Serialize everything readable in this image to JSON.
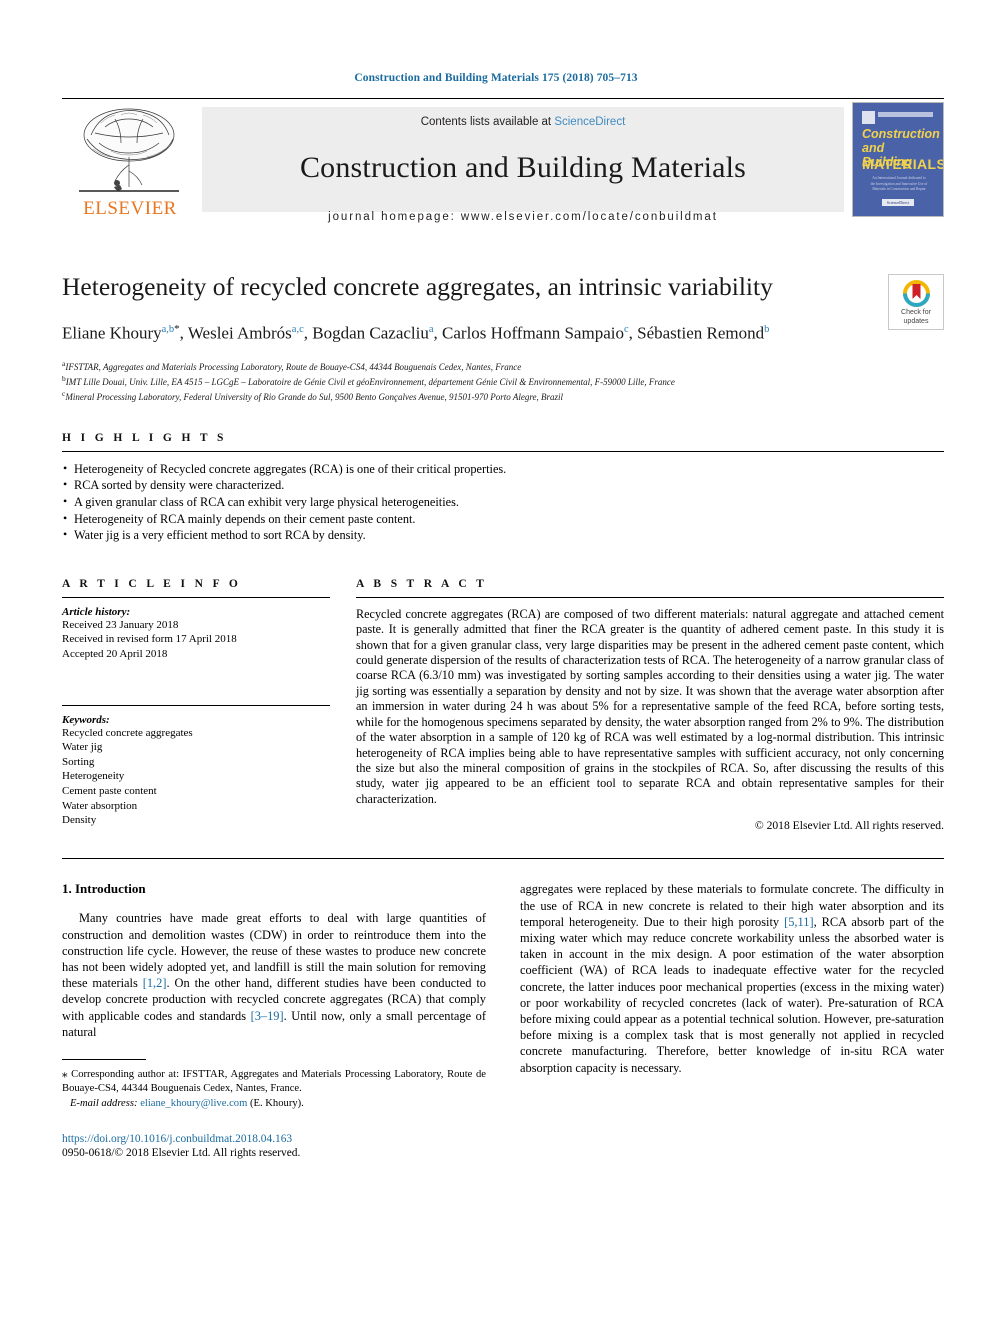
{
  "running_head": "Construction and Building Materials 175 (2018) 705–713",
  "masthead": {
    "publisher": "ELSEVIER",
    "contents_prefix": "Contents lists available at ",
    "contents_link": "ScienceDirect",
    "journal_title": "Construction and Building Materials",
    "homepage": "journal homepage: www.elsevier.com/locate/conbuildmat",
    "cover": {
      "line1": "Construction",
      "line2": "and Building",
      "line3": "MATERIALS",
      "blurb": "An International Journal dedicated to the Investigation and Innovative Use of Materials in Construction and Repair",
      "footer": "ScienceDirect"
    }
  },
  "article": {
    "title": "Heterogeneity of recycled concrete aggregates, an intrinsic variability",
    "crossmark": {
      "line1": "Check for",
      "line2": "updates"
    },
    "authors": [
      {
        "name": "Eliane Khoury",
        "marks": "a,b",
        "star": "*",
        "sep": ", "
      },
      {
        "name": "Weslei Ambrós",
        "marks": "a,c",
        "star": "",
        "sep": ", "
      },
      {
        "name": "Bogdan Cazacliu",
        "marks": "a",
        "star": "",
        "sep": ", "
      },
      {
        "name": "Carlos Hoffmann Sampaio",
        "marks": "c",
        "star": "",
        "sep": ","
      },
      {
        "name": "Sébastien Remond",
        "marks": "b",
        "star": "",
        "sep": ""
      }
    ],
    "affiliations": [
      {
        "mark": "a",
        "text": "IFSTTAR, Aggregates and Materials Processing Laboratory, Route de Bouaye-CS4, 44344 Bouguenais Cedex, Nantes, France"
      },
      {
        "mark": "b",
        "text": "IMT Lille Douai, Univ. Lille, EA 4515 – LGCgE – Laboratoire de Génie Civil et géoEnvironnement, département Génie Civil & Environnemental, F-59000 Lille, France"
      },
      {
        "mark": "c",
        "text": "Mineral Processing Laboratory, Federal University of Rio Grande do Sul, 9500 Bento Gonçalves Avenue, 91501-970 Porto Alegre, Brazil"
      }
    ]
  },
  "highlights": {
    "label": "H I G H L I G H T S",
    "items": [
      "Heterogeneity of Recycled concrete aggregates (RCA) is one of their critical properties.",
      "RCA sorted by density were characterized.",
      "A given granular class of RCA can exhibit very large physical heterogeneities.",
      "Heterogeneity of RCA mainly depends on their cement paste content.",
      "Water jig is a very efficient method to sort RCA by density."
    ]
  },
  "article_info": {
    "label": "A R T I C L E  I N F O",
    "history_label": "Article history:",
    "history": [
      "Received 23 January 2018",
      "Received in revised form 17 April 2018",
      "Accepted 20 April 2018"
    ],
    "keywords_label": "Keywords:",
    "keywords": [
      "Recycled concrete aggregates",
      "Water jig",
      "Sorting",
      "Heterogeneity",
      "Cement paste content",
      "Water absorption",
      "Density"
    ]
  },
  "abstract": {
    "label": "A B S T R A C T",
    "text": "Recycled concrete aggregates (RCA) are composed of two different materials: natural aggregate and attached cement paste. It is generally admitted that finer the RCA greater is the quantity of adhered cement paste. In this study it is shown that for a given granular class, very large disparities may be present in the adhered cement paste content, which could generate dispersion of the results of characterization tests of RCA. The heterogeneity of a narrow granular class of coarse RCA (6.3/10 mm) was investigated by sorting samples according to their densities using a water jig. The water jig sorting was essentially a separation by density and not by size. It was shown that the average water absorption after an immersion in water during 24 h was about 5% for a representative sample of the feed RCA, before sorting tests, while for the homogenous specimens separated by density, the water absorption ranged from 2% to 9%. The distribution of the water absorption in a sample of 120 kg of RCA was well estimated by a log-normal distribution. This intrinsic heterogeneity of RCA implies being able to have representative samples with sufficient accuracy, not only concerning the size but also the mineral composition of grains in the stockpiles of RCA. So, after discussing the results of this study, water jig appeared to be an efficient tool to separate RCA and obtain representative samples for their characterization.",
    "copyright": "© 2018 Elsevier Ltd. All rights reserved."
  },
  "introduction": {
    "heading": "1. Introduction",
    "left_para_1": "Many countries have made great efforts to deal with large quantities of construction and demolition wastes (CDW) in order to reintroduce them into the construction life cycle. However, the reuse of these wastes to produce new concrete has not been widely adopted yet, and landfill is still the main solution for removing these materials ",
    "left_ref_1": "[1,2]",
    "left_para_2": ". On the other hand, different studies have been conducted to develop concrete production with recycled concrete aggregates (RCA) that comply with applicable codes and standards ",
    "left_ref_2": "[3–19]",
    "left_para_3": ". Until now, only a small percentage of natural",
    "right_para_1": "aggregates were replaced by these materials to formulate concrete. The difficulty in the use of RCA in new concrete is related to their high water absorption and its temporal heterogeneity. Due to their high porosity ",
    "right_ref_1": "[5,11]",
    "right_para_2": ", RCA absorb part of the mixing water which may reduce concrete workability unless the absorbed water is taken in account in the mix design. A poor estimation of the water absorption coefficient (WA) of RCA leads to inadequate effective water for the recycled concrete, the latter induces poor mechanical properties (excess in the mixing water) or poor workability of recycled concretes (lack of water). Pre-saturation of RCA before mixing could appear as a potential technical solution. However, pre-saturation before mixing is a complex task that is most generally not applied in recycled concrete manufacturing. Therefore, better knowledge of in-situ RCA water absorption capacity is necessary."
  },
  "footnote": {
    "star": "⁎",
    "text": "Corresponding author at: IFSTTAR, Aggregates and Materials Processing Laboratory, Route de Bouaye-CS4, 44344 Bouguenais Cedex, Nantes, France.",
    "email_label": "E-mail address:",
    "email": "eliane_khoury@live.com",
    "email_owner": "(E. Khoury)."
  },
  "footer": {
    "doi": "https://doi.org/10.1016/j.conbuildmat.2018.04.163",
    "issn_line": "0950-0618/© 2018 Elsevier Ltd. All rights reserved."
  },
  "colors": {
    "link": "#1a6ba0",
    "elsevier_orange": "#E87722",
    "cover_blue": "#4a63a8"
  }
}
